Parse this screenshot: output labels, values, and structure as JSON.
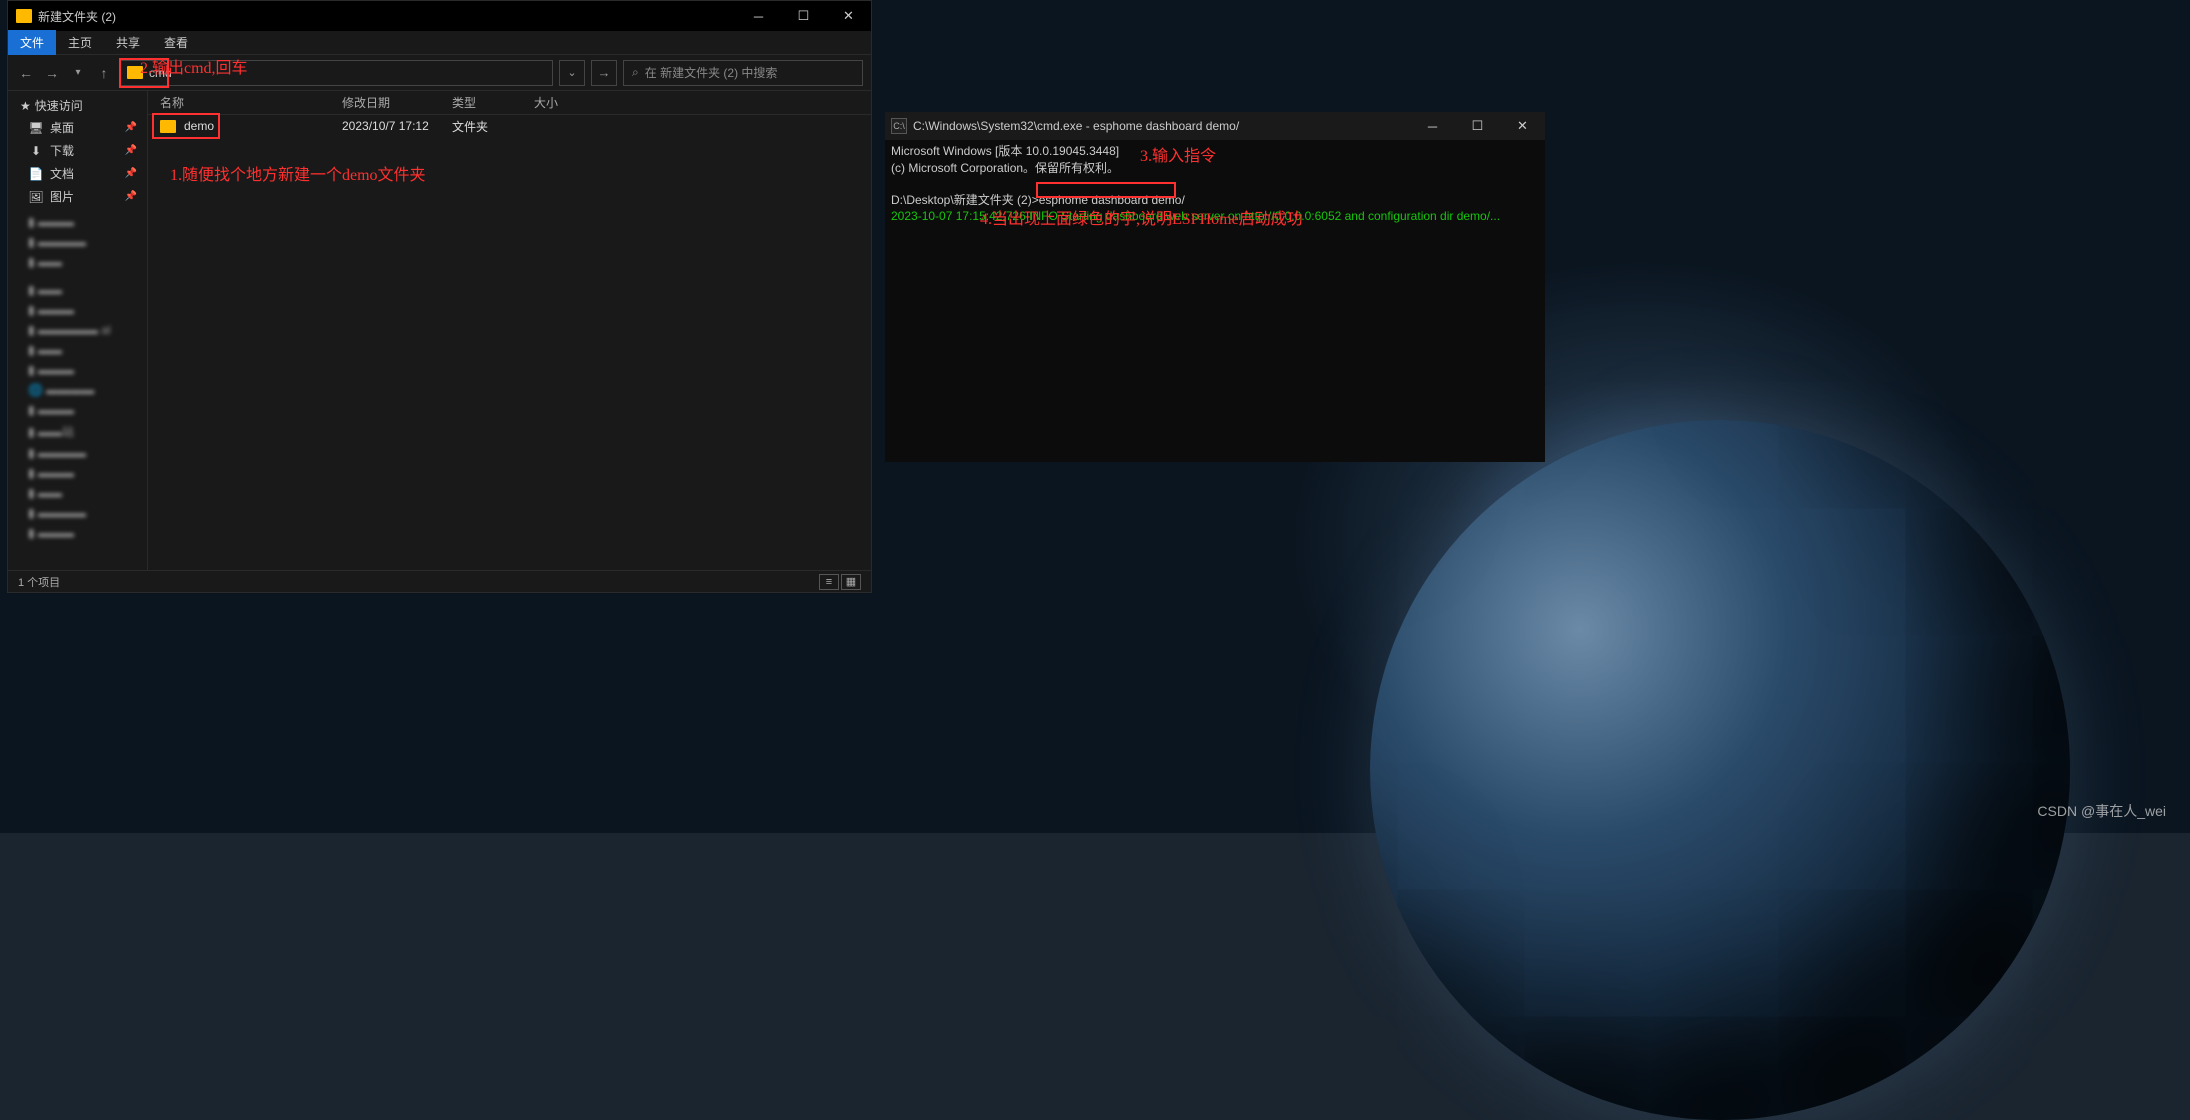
{
  "explorer": {
    "title": "新建文件夹 (2)",
    "ribbon": {
      "file": "文件",
      "home": "主页",
      "share": "共享",
      "view": "查看"
    },
    "address": "cmd",
    "search_placeholder": "在 新建文件夹 (2) 中搜索",
    "quick_access": "快速访问",
    "side_items": [
      {
        "label": "桌面",
        "icon": "🖥"
      },
      {
        "label": "下载",
        "icon": "⬇"
      },
      {
        "label": "文档",
        "icon": "📄"
      },
      {
        "label": "图片",
        "icon": "🖼"
      }
    ],
    "columns": {
      "name": "名称",
      "date": "修改日期",
      "type": "类型",
      "size": "大小"
    },
    "files": [
      {
        "name": "demo",
        "date": "2023/10/7 17:12",
        "type": "文件夹",
        "size": ""
      }
    ],
    "status": "1 个项目"
  },
  "terminal": {
    "title": "C:\\Windows\\System32\\cmd.exe - esphome  dashboard demo/",
    "line1": "Microsoft Windows [版本 10.0.19045.3448]",
    "line2": "(c) Microsoft Corporation。保留所有权利。",
    "prompt": "D:\\Desktop\\新建文件夹 (2)>",
    "command": "esphome dashboard demo/",
    "output": "2023-10-07 17:15:42,726 INFO Starting dashboard web server on http://0.0.0.0:6052 and configuration dir demo/..."
  },
  "annotations": {
    "a1": "1.随便找个地方新建一个demo文件夹",
    "a2": "2.输出cmd,回车",
    "a3": "3.输入指令",
    "a4": "4.当出现上面绿色的字,说明ESPHome启动成功"
  },
  "watermark": "CSDN @事在人_wei",
  "search_icon": "⌕"
}
